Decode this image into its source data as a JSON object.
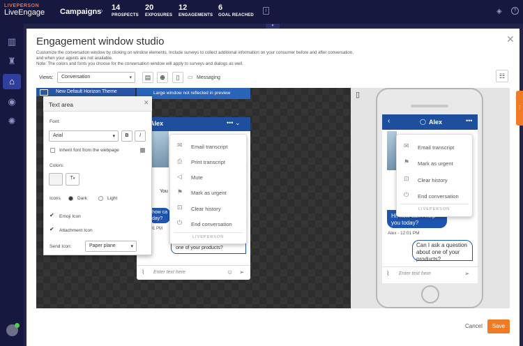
{
  "brand": {
    "line1": "LIVEPERSON",
    "line2": "LiveEngage"
  },
  "nav": {
    "campaigns": "Campaigns",
    "stats": [
      {
        "value": "14",
        "label": "PROSPECTS"
      },
      {
        "value": "20",
        "label": "EXPOSURES"
      },
      {
        "value": "12",
        "label": "ENGAGEMENTS"
      },
      {
        "value": "6",
        "label": "GOAL REACHED"
      }
    ]
  },
  "modal": {
    "title": "Engagement window studio",
    "description_1": "Customize the conversation window by clicking on window elements. Include surveys to collect additional information on your consumer before and after conversation,",
    "description_2": "and when your agents are not available.",
    "description_3": "Note: The colors and fonts you choose for the conversation window will apply to surveys and dialogs as well.",
    "views_label": "Views:",
    "views_value": "Conversation",
    "messaging_label": "Messaging",
    "cancel": "Cancel",
    "save": "Save"
  },
  "banners": {
    "theme": "New Default Horizon Theme",
    "large_window": "Large window not reflected in preview"
  },
  "text_area": {
    "title": "Text area",
    "font_label": "Font:",
    "font_value": "Arial",
    "bold": "B",
    "italic": "I",
    "inherit_label": "Inherit font from the webpage",
    "colors_label": "Colors:",
    "text_color_glyph": "T",
    "icons_label": "Icons",
    "dark": "Dark",
    "light": "Light",
    "emoji_label": "Emoji Icon",
    "attachment_label": "Attachment Icon",
    "send_icon_label": "Send Icon:",
    "send_icon_value": "Paper plane"
  },
  "mid_window": {
    "agent_name": "Alex",
    "you_fragment": "You",
    "agent_msg_1": "how ca",
    "agent_msg_2": "day?",
    "time": "x - 12:01 PM",
    "user_msg": "one of your products?",
    "input_placeholder": "Enter text here",
    "menu": [
      {
        "icon": "email-icon",
        "label": "Email transcript"
      },
      {
        "icon": "print-icon",
        "label": "Print transcript"
      },
      {
        "icon": "mute-icon",
        "label": "Mute"
      },
      {
        "icon": "flag-icon",
        "label": "Mark as urgent"
      },
      {
        "icon": "clear-icon",
        "label": "Clear history"
      },
      {
        "icon": "power-icon",
        "label": "End conversation"
      }
    ],
    "menu_footer": "LIVEPERSON"
  },
  "phone": {
    "agent_name": "Alex",
    "agent_msg_1": "Hi, how can I help",
    "agent_msg_2": "you today?",
    "time": "Alex - 12:01 PM",
    "user_msg": "Can I ask a question about one of your products?",
    "input_placeholder": "Enter text here",
    "menu": [
      {
        "icon": "email-icon",
        "label": "Email transcript"
      },
      {
        "icon": "flag-icon",
        "label": "Mark as urgent"
      },
      {
        "icon": "clear-icon",
        "label": "Clear history"
      },
      {
        "icon": "power-icon",
        "label": "End conversation"
      }
    ],
    "menu_footer": "LIVEPERSON"
  },
  "colors": {
    "accent": "#f07b24",
    "brand_blue": "#1e4f9e",
    "nav_bg": "#171840"
  }
}
